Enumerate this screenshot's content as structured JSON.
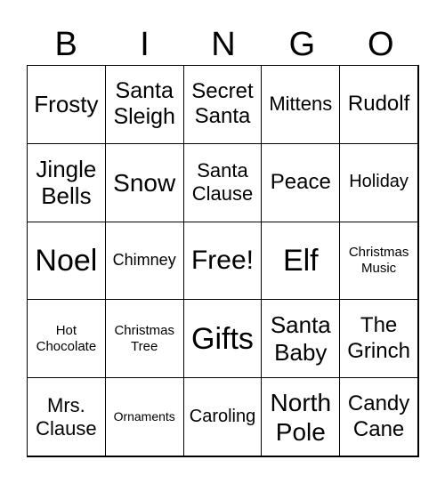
{
  "header": [
    "B",
    "I",
    "N",
    "G",
    "O"
  ],
  "cells": [
    [
      "Frosty",
      "Santa Sleigh",
      "Secret Santa",
      "Mittens",
      "Rudolf"
    ],
    [
      "Jingle Bells",
      "Snow",
      "Santa Clause",
      "Peace",
      "Holiday"
    ],
    [
      "Noel",
      "Chimney",
      "Free!",
      "Elf",
      "Christmas Music"
    ],
    [
      "Hot Chocolate",
      "Christmas Tree",
      "Gifts",
      "Santa Baby",
      "The Grinch"
    ],
    [
      "Mrs. Clause",
      "Ornaments",
      "Caroling",
      "North Pole",
      "Candy Cane"
    ]
  ]
}
